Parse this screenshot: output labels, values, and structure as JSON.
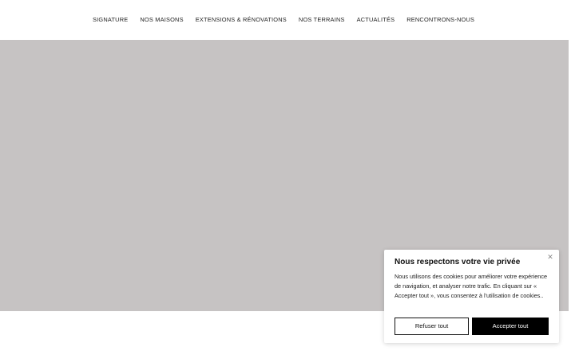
{
  "nav": {
    "items": [
      {
        "label": "SIGNATURE"
      },
      {
        "label": "NOS MAISONS"
      },
      {
        "label": "EXTENSIONS & RÉNOVATIONS"
      },
      {
        "label": "NOS TERRAINS"
      },
      {
        "label": "ACTUALITÉS"
      },
      {
        "label": "RENCONTRONS-NOUS"
      }
    ]
  },
  "cookie_banner": {
    "title": "Nous respectons votre vie privée",
    "body": "Nous utilisons des cookies pour améliorer votre expérience de navigation, et analyser notre trafic. En cliquant sur « Accepter tout », vous consentez à l'utilisation de cookies..",
    "refuse_label": "Refuser tout",
    "accept_label": "Accepter tout",
    "close_icon": "close-icon"
  },
  "colors": {
    "hero_background": "#c6c3c3",
    "accept_button": "#000000"
  }
}
